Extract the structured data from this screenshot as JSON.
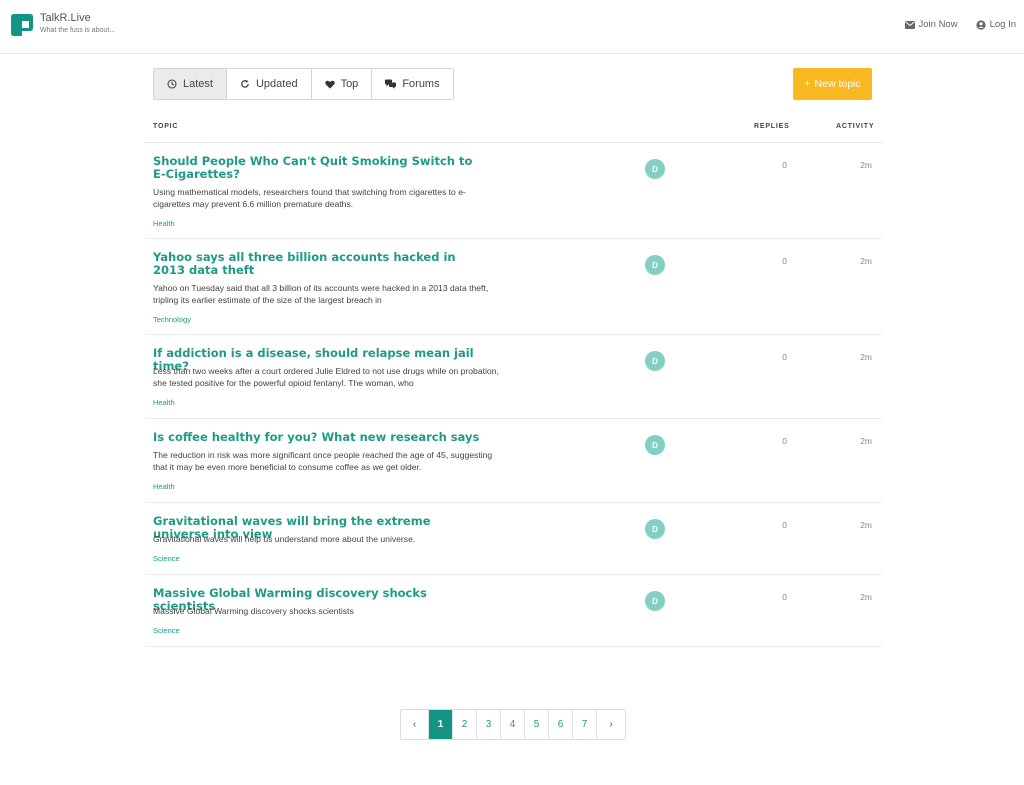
{
  "header": {
    "brand_name": "TalkR.Live",
    "tagline": "What the fuss is about...",
    "join_label": "Join Now",
    "login_label": "Log In",
    "brand_color": "#149484"
  },
  "tabs": [
    {
      "label": "Latest",
      "icon": "clock-icon",
      "active": true
    },
    {
      "label": "Updated",
      "icon": "refresh-icon",
      "active": false
    },
    {
      "label": "Top",
      "icon": "heart-icon",
      "active": false
    },
    {
      "label": "Forums",
      "icon": "chat-bubbles-icon",
      "active": false
    }
  ],
  "new_topic_label": "New topic",
  "new_topic_color": "#f8b820",
  "columns": {
    "topic": "TOPIC",
    "replies": "REPLIES",
    "activity": "ACTIVITY"
  },
  "topics": [
    {
      "title": "Should People Who Can't Quit Smoking Switch to E-Cigarettes?",
      "excerpt": "Using mathematical models, researchers found that switching from cigarettes to e-cigarettes may prevent 6.6 million premature deaths.",
      "category": "Health",
      "avatar": "D",
      "replies": "0",
      "activity": "2m"
    },
    {
      "title": "Yahoo says all three billion accounts hacked in 2013 data theft",
      "excerpt": "Yahoo on Tuesday said that all 3 billion of its accounts were hacked in a 2013 data theft, tripling its earlier estimate of the size of the largest breach in",
      "category": "Technology",
      "avatar": "D",
      "replies": "0",
      "activity": "2m"
    },
    {
      "title": "If addiction is a disease, should relapse mean jail time?",
      "excerpt": "Less than two weeks after a court ordered Julie Eldred to not use drugs while on probation, she tested positive for the powerful opioid fentanyl. The woman, who",
      "category": "Health",
      "avatar": "D",
      "replies": "0",
      "activity": "2m"
    },
    {
      "title": "Is coffee healthy for you? What new research says",
      "excerpt": "The reduction in risk was more significant once people reached the age of 45, suggesting that it may be even more beneficial to consume coffee as we get older.",
      "category": "Health",
      "avatar": "D",
      "replies": "0",
      "activity": "2m"
    },
    {
      "title": "Gravitational waves will bring the extreme universe into view",
      "excerpt": "Gravitational waves will help us understand more about the universe.",
      "category": "Science",
      "avatar": "D",
      "replies": "0",
      "activity": "2m"
    },
    {
      "title": "Massive Global Warming discovery shocks scientists",
      "excerpt": "Massive Global Warming discovery shocks scientists",
      "category": "Science",
      "avatar": "D",
      "replies": "0",
      "activity": "2m"
    }
  ],
  "pagination": {
    "prev": "‹",
    "next": "›",
    "pages": [
      "1",
      "2",
      "3",
      "4",
      "5",
      "6",
      "7"
    ],
    "current": "1"
  }
}
